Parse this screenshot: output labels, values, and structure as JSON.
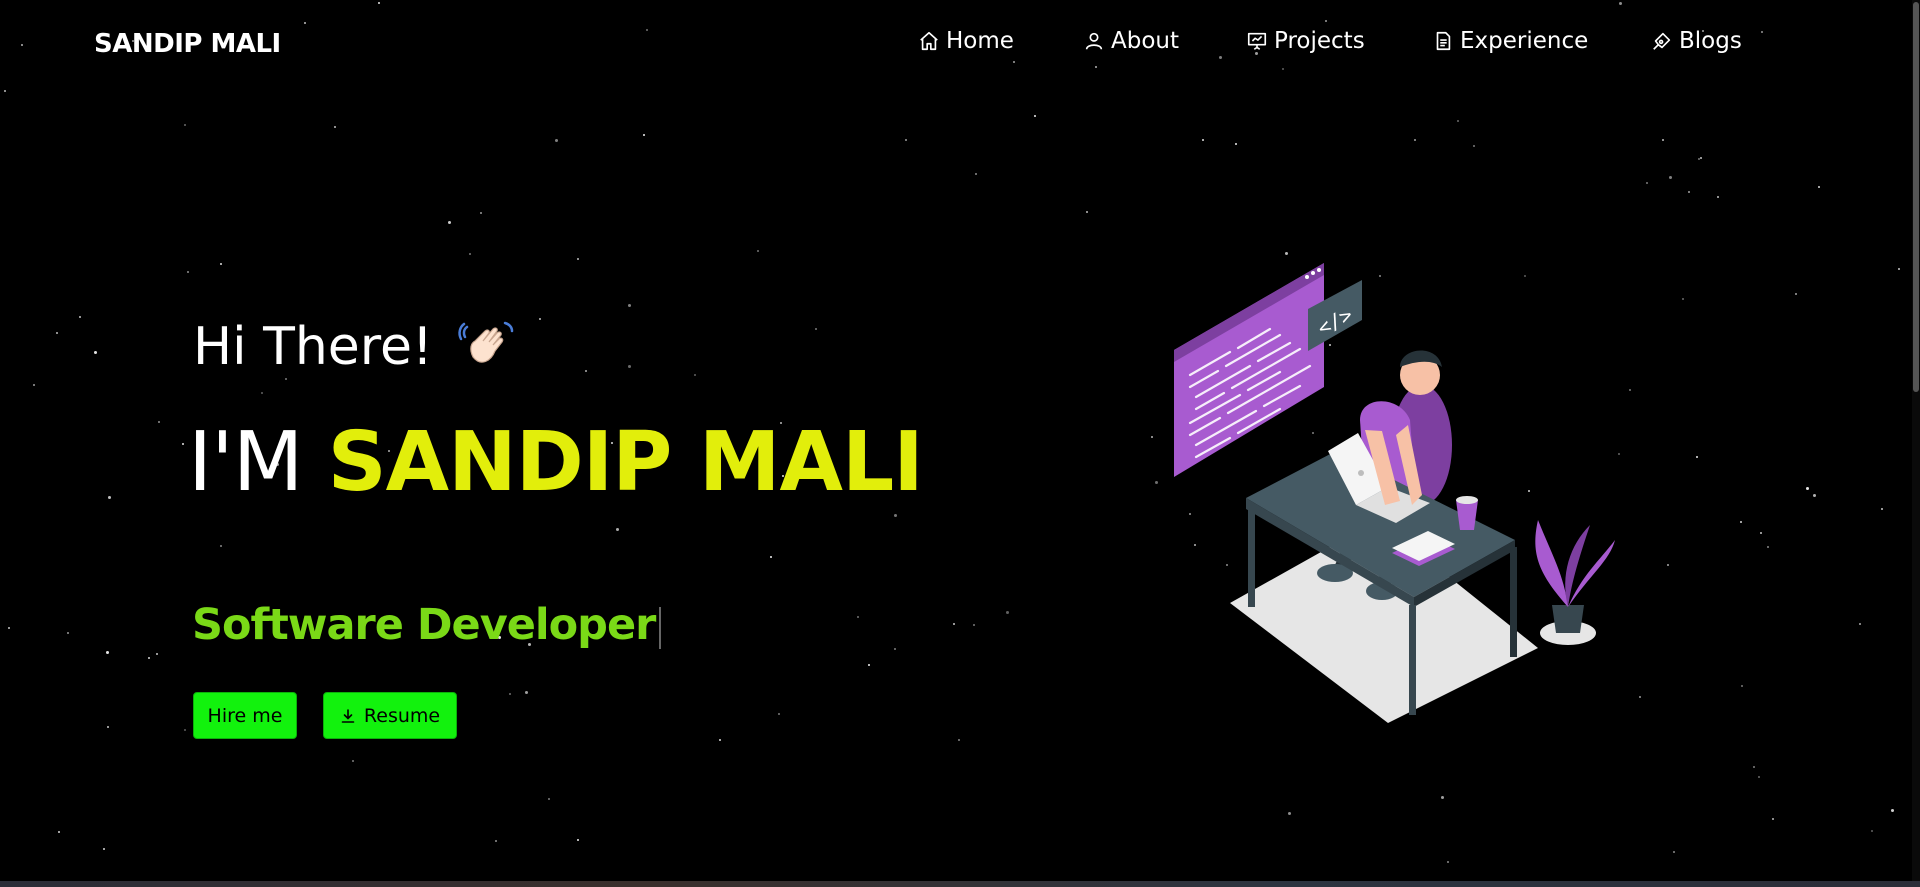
{
  "brand": "SANDIP MALI",
  "nav": [
    {
      "label": "Home",
      "icon": "home-icon"
    },
    {
      "label": "About",
      "icon": "user-icon"
    },
    {
      "label": "Projects",
      "icon": "presentation-icon"
    },
    {
      "label": "Experience",
      "icon": "document-icon"
    },
    {
      "label": "Blogs",
      "icon": "pen-nib-icon"
    }
  ],
  "hero": {
    "greeting": "Hi There!",
    "headline_prefix": "I'M",
    "headline_name": "SANDIP MALI",
    "role": "Software Developer",
    "hire_button": "Hire me",
    "resume_button": "Resume"
  },
  "colors": {
    "background": "#000000",
    "accent_yellow": "#e2ee0b",
    "role_green": "#7ad917",
    "button_green": "#12f20d",
    "illustration_purple": "#a85bd0",
    "desk_gray": "#37474f"
  }
}
